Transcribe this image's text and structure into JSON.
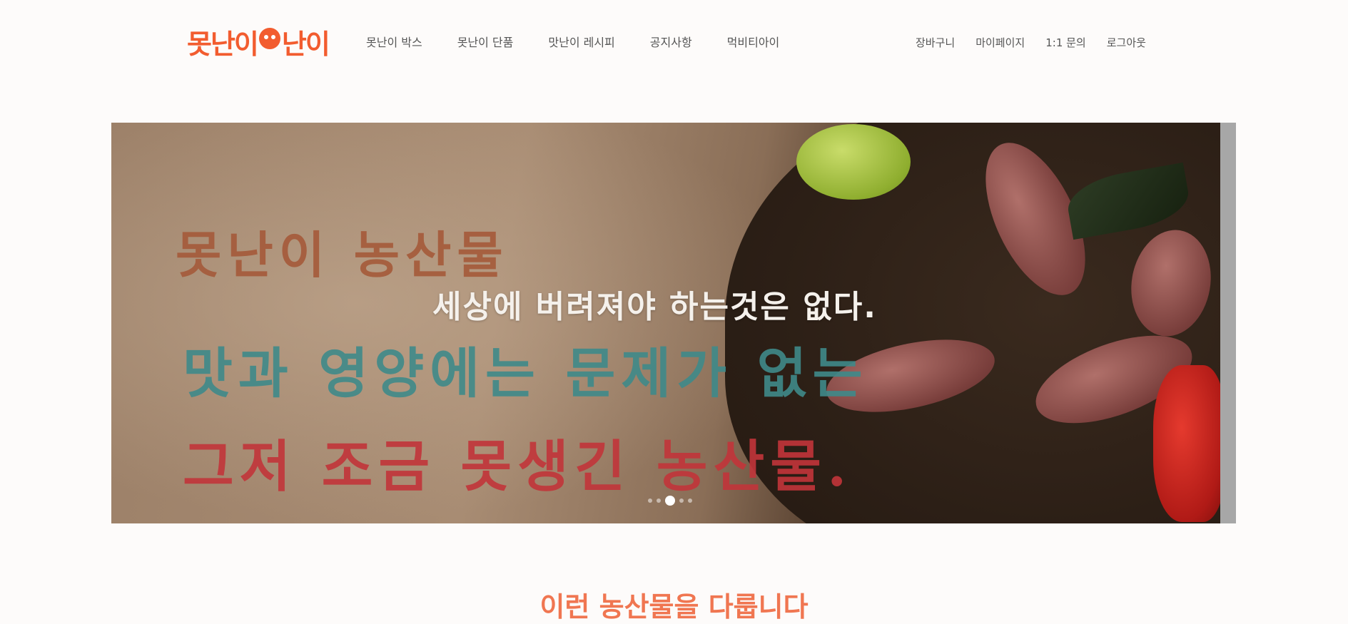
{
  "header": {
    "logo_text": "못난이 농난이",
    "nav_main": [
      "못난이 박스",
      "못난이 단품",
      "맛난이 레시피",
      "공지사항",
      "먹비티아이"
    ],
    "nav_util": [
      "장바구니",
      "마이페이지",
      "1:1 문의",
      "로그아웃"
    ]
  },
  "hero": {
    "crayon_line1": "못난이 농산물",
    "crayon_line2": "맛과 영양에는 문제가 없는",
    "crayon_line3": "그저 조금 못생긴 농산물.",
    "slogan": "세상에 버려져야 하는것은 없다.",
    "slide_count": 5,
    "active_slide": 3
  },
  "section": {
    "title": "이런 농산물을 다룹니다"
  },
  "colors": {
    "brand": "#f25c2f",
    "section_title": "#f07651"
  }
}
